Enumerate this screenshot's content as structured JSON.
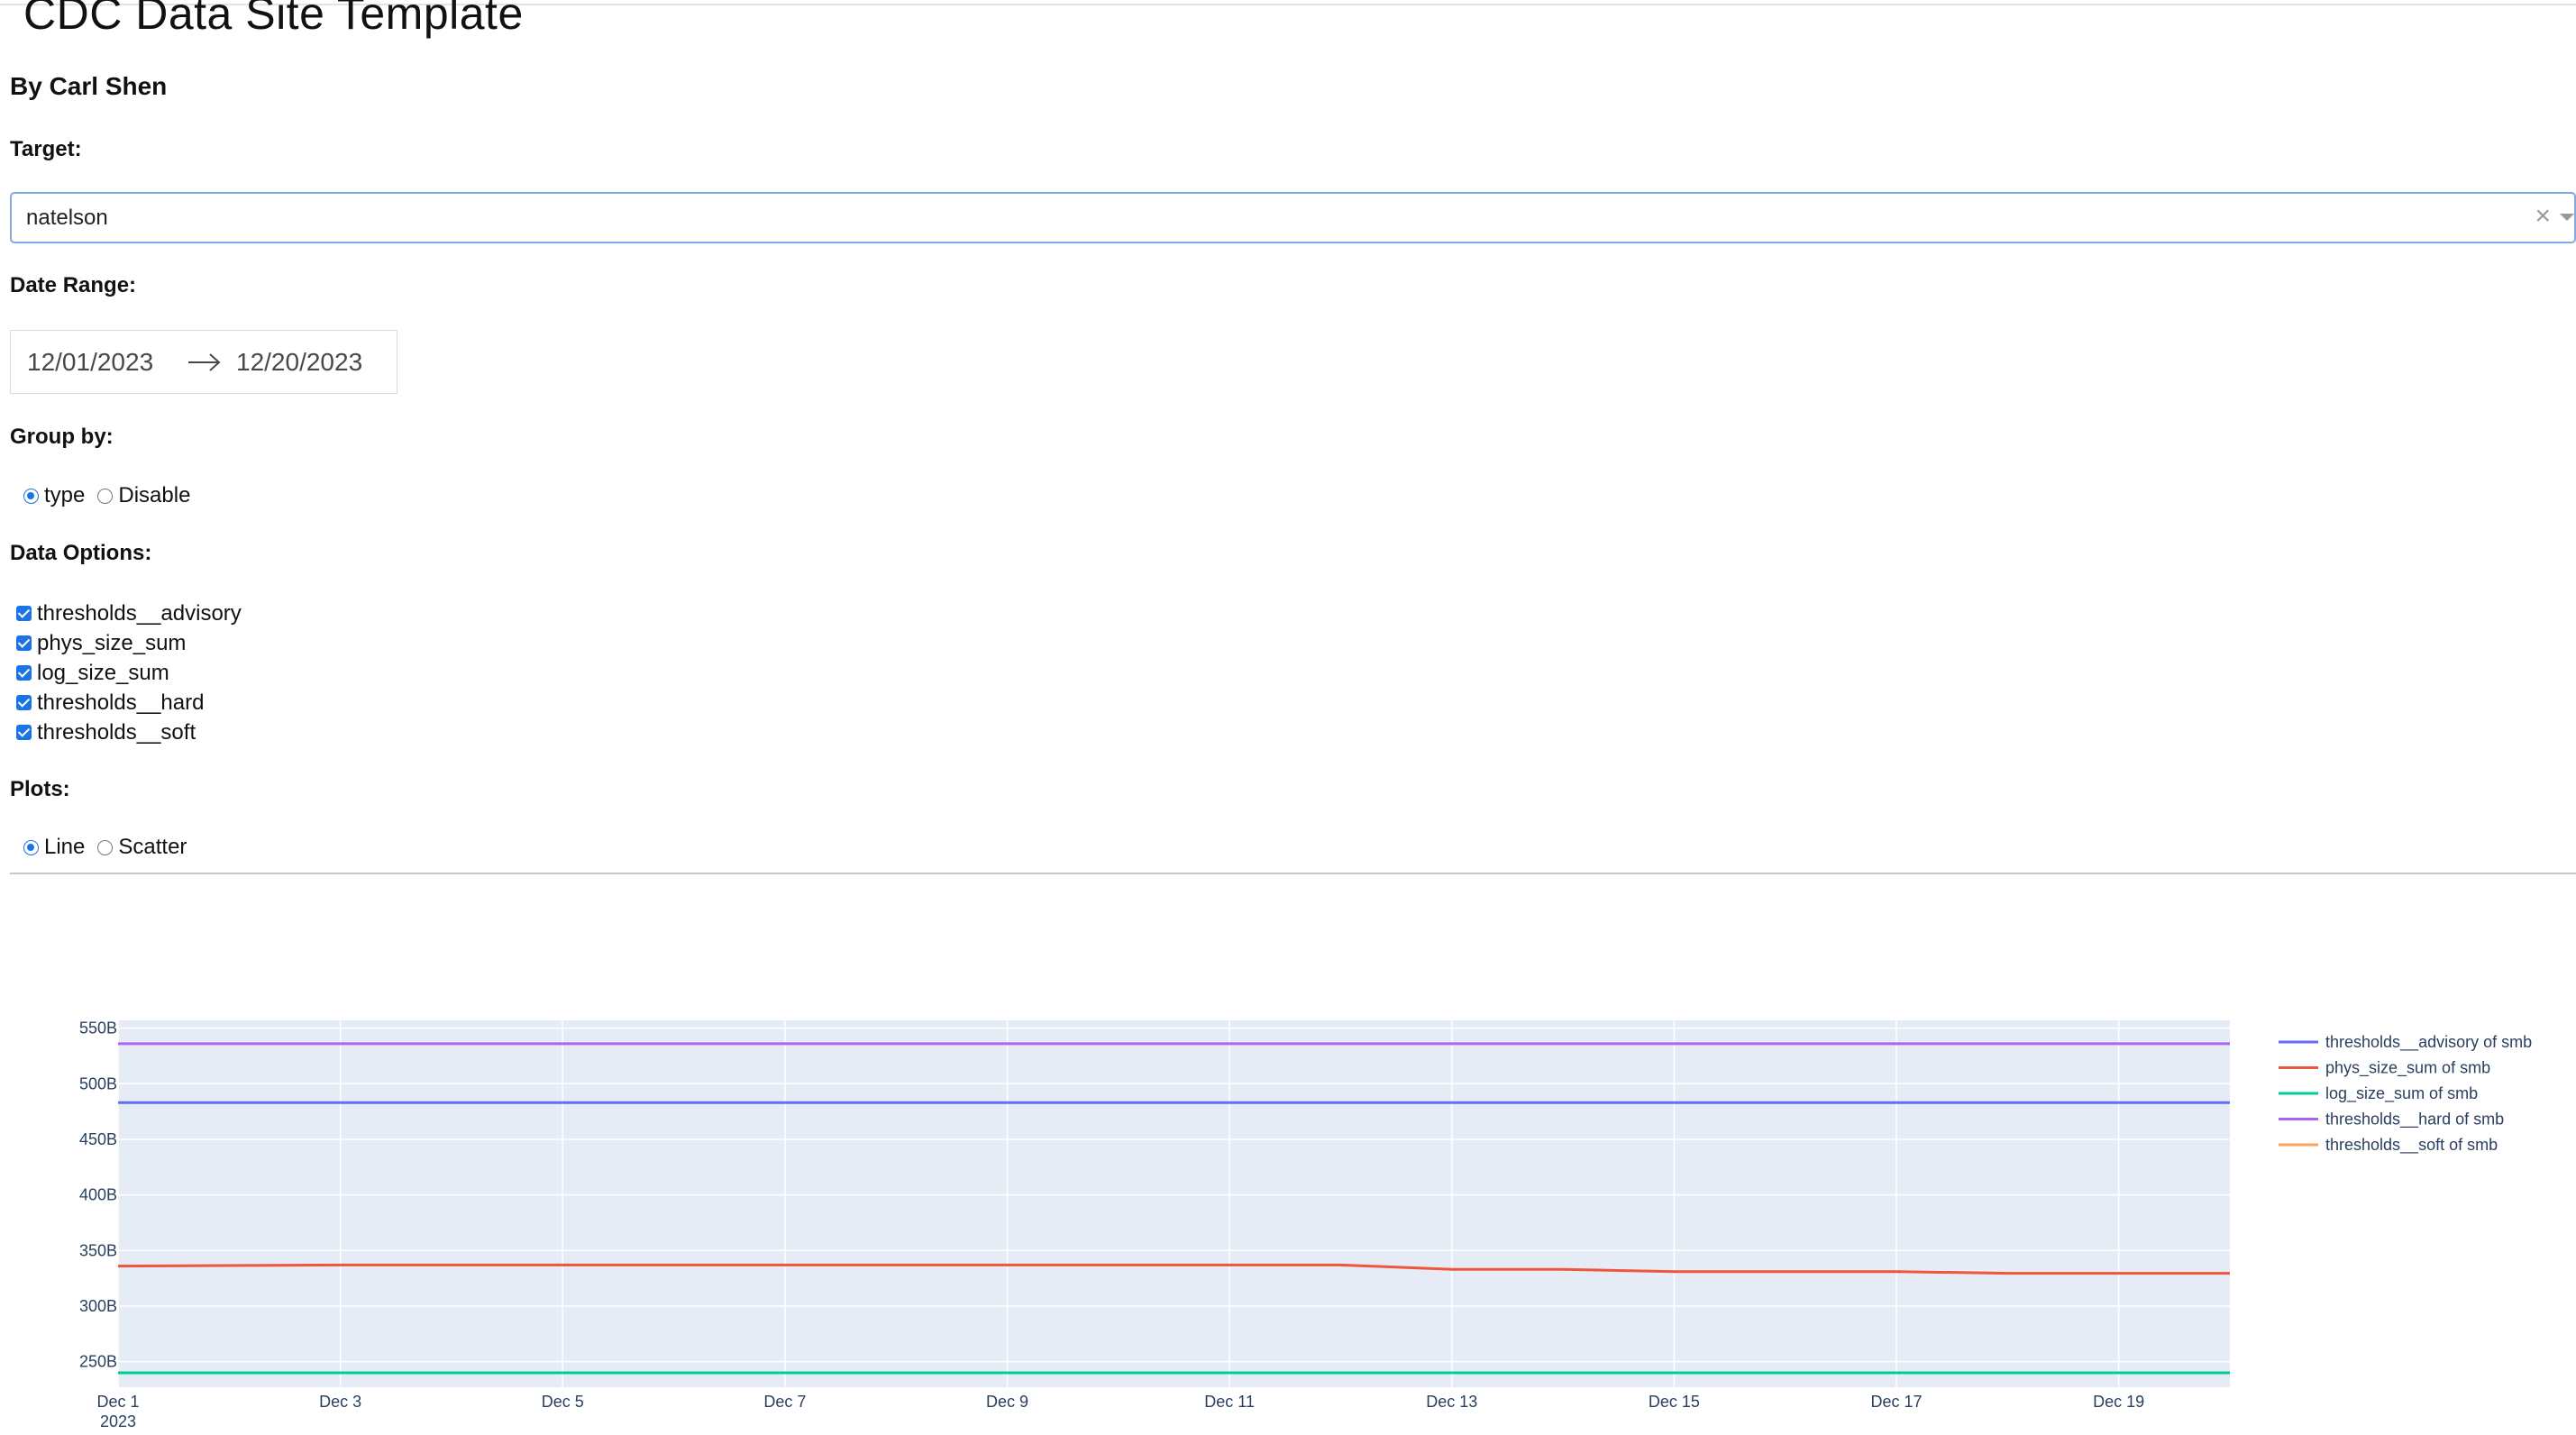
{
  "header": {
    "title": "CDC Data Site Template",
    "byline": "By Carl Shen"
  },
  "target": {
    "label": "Target:",
    "value": "natelson",
    "clear_glyph": "×"
  },
  "date_range": {
    "label": "Date Range:",
    "start": "12/01/2023",
    "end": "12/20/2023"
  },
  "group_by": {
    "label": "Group by:",
    "options": [
      "type",
      "Disable"
    ],
    "selected": "type"
  },
  "data_options": {
    "label": "Data Options:",
    "items": [
      "thresholds__advisory",
      "phys_size_sum",
      "log_size_sum",
      "thresholds__hard",
      "thresholds__soft"
    ],
    "checked": [
      "thresholds__advisory",
      "phys_size_sum",
      "log_size_sum",
      "thresholds__hard",
      "thresholds__soft"
    ]
  },
  "plots": {
    "label": "Plots:",
    "options": [
      "Line",
      "Scatter"
    ],
    "selected": "Line"
  },
  "colors": {
    "accent": "#1a73e8",
    "plot_bg": "#e5ecf6"
  },
  "chart_data": {
    "type": "line",
    "title": "",
    "xlabel": "",
    "ylabel": "",
    "x_ticks": [
      "Dec 1",
      "Dec 3",
      "Dec 5",
      "Dec 7",
      "Dec 9",
      "Dec 11",
      "Dec 13",
      "Dec 15",
      "Dec 17",
      "Dec 19"
    ],
    "x_year_label": "2023",
    "y_ticks": [
      "250B",
      "300B",
      "350B",
      "400B",
      "450B",
      "500B",
      "550B"
    ],
    "x_range": [
      "2023-12-01",
      "2023-12-20"
    ],
    "ylim": [
      227,
      557
    ],
    "grid": true,
    "legend_position": "right",
    "dates": [
      "2023-12-01",
      "2023-12-02",
      "2023-12-03",
      "2023-12-04",
      "2023-12-05",
      "2023-12-06",
      "2023-12-07",
      "2023-12-08",
      "2023-12-09",
      "2023-12-10",
      "2023-12-11",
      "2023-12-12",
      "2023-12-13",
      "2023-12-14",
      "2023-12-15",
      "2023-12-16",
      "2023-12-17",
      "2023-12-18",
      "2023-12-19",
      "2023-12-20"
    ],
    "series": [
      {
        "name": "thresholds__advisory of smb",
        "color": "#636efa",
        "values": [
          483,
          483,
          483,
          483,
          483,
          483,
          483,
          483,
          483,
          483,
          483,
          483,
          483,
          483,
          483,
          483,
          483,
          483,
          483,
          483
        ]
      },
      {
        "name": "phys_size_sum of smb",
        "color": "#ef553b",
        "values": [
          336,
          336.5,
          337,
          337,
          337,
          337,
          337,
          337,
          337,
          337,
          337,
          337,
          333,
          333,
          331,
          331,
          331,
          329.5,
          329.5,
          329.5
        ]
      },
      {
        "name": "log_size_sum of smb",
        "color": "#00cc96",
        "values": [
          240,
          240,
          240,
          240,
          240,
          240,
          240,
          240,
          240,
          240,
          240,
          240,
          240,
          240,
          240,
          240,
          240,
          240,
          240,
          240
        ]
      },
      {
        "name": "thresholds__hard of smb",
        "color": "#ab63fa",
        "values": [
          536,
          536,
          536,
          536,
          536,
          536,
          536,
          536,
          536,
          536,
          536,
          536,
          536,
          536,
          536,
          536,
          536,
          536,
          536,
          536
        ]
      },
      {
        "name": "thresholds__soft of smb",
        "color": "#ffa15a",
        "values": []
      }
    ]
  }
}
